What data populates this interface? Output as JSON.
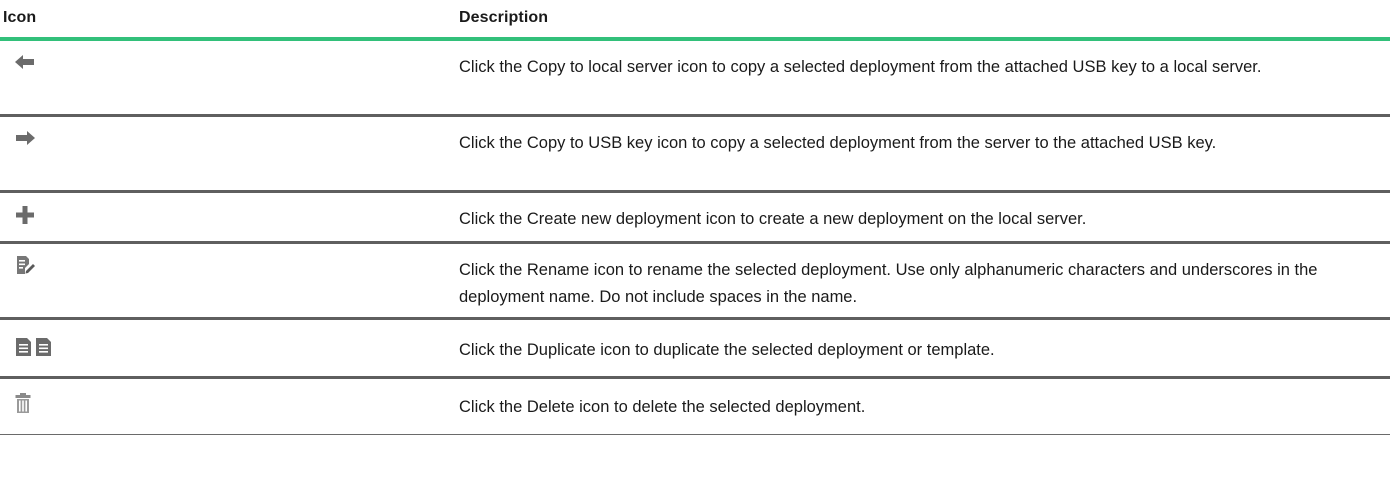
{
  "header": {
    "icon_col": "Icon",
    "description_col": "Description"
  },
  "colors": {
    "header_rule": "#32c07a",
    "row_rule": "#5f5f5f",
    "icon_gray": "#6b6b6b"
  },
  "rows": [
    {
      "icon": "arrow-left-icon",
      "description": "Click the Copy to local server icon to copy a selected deployment from the attached USB key to a local server."
    },
    {
      "icon": "arrow-right-icon",
      "description": "Click the Copy to USB key icon to copy a selected deployment from the server to the attached USB key."
    },
    {
      "icon": "plus-icon",
      "description": "Click the Create new deployment  icon to create a new deployment on the local server."
    },
    {
      "icon": "rename-icon",
      "description": "Click the Rename icon to rename the selected deployment. Use only alphanumeric characters and underscores in the deployment name. Do not include spaces in the name."
    },
    {
      "icon": "duplicate-icon",
      "description": "Click the Duplicate icon to duplicate the selected deployment or template."
    },
    {
      "icon": "trash-icon",
      "description": "Click the Delete icon to delete the selected deployment."
    }
  ]
}
